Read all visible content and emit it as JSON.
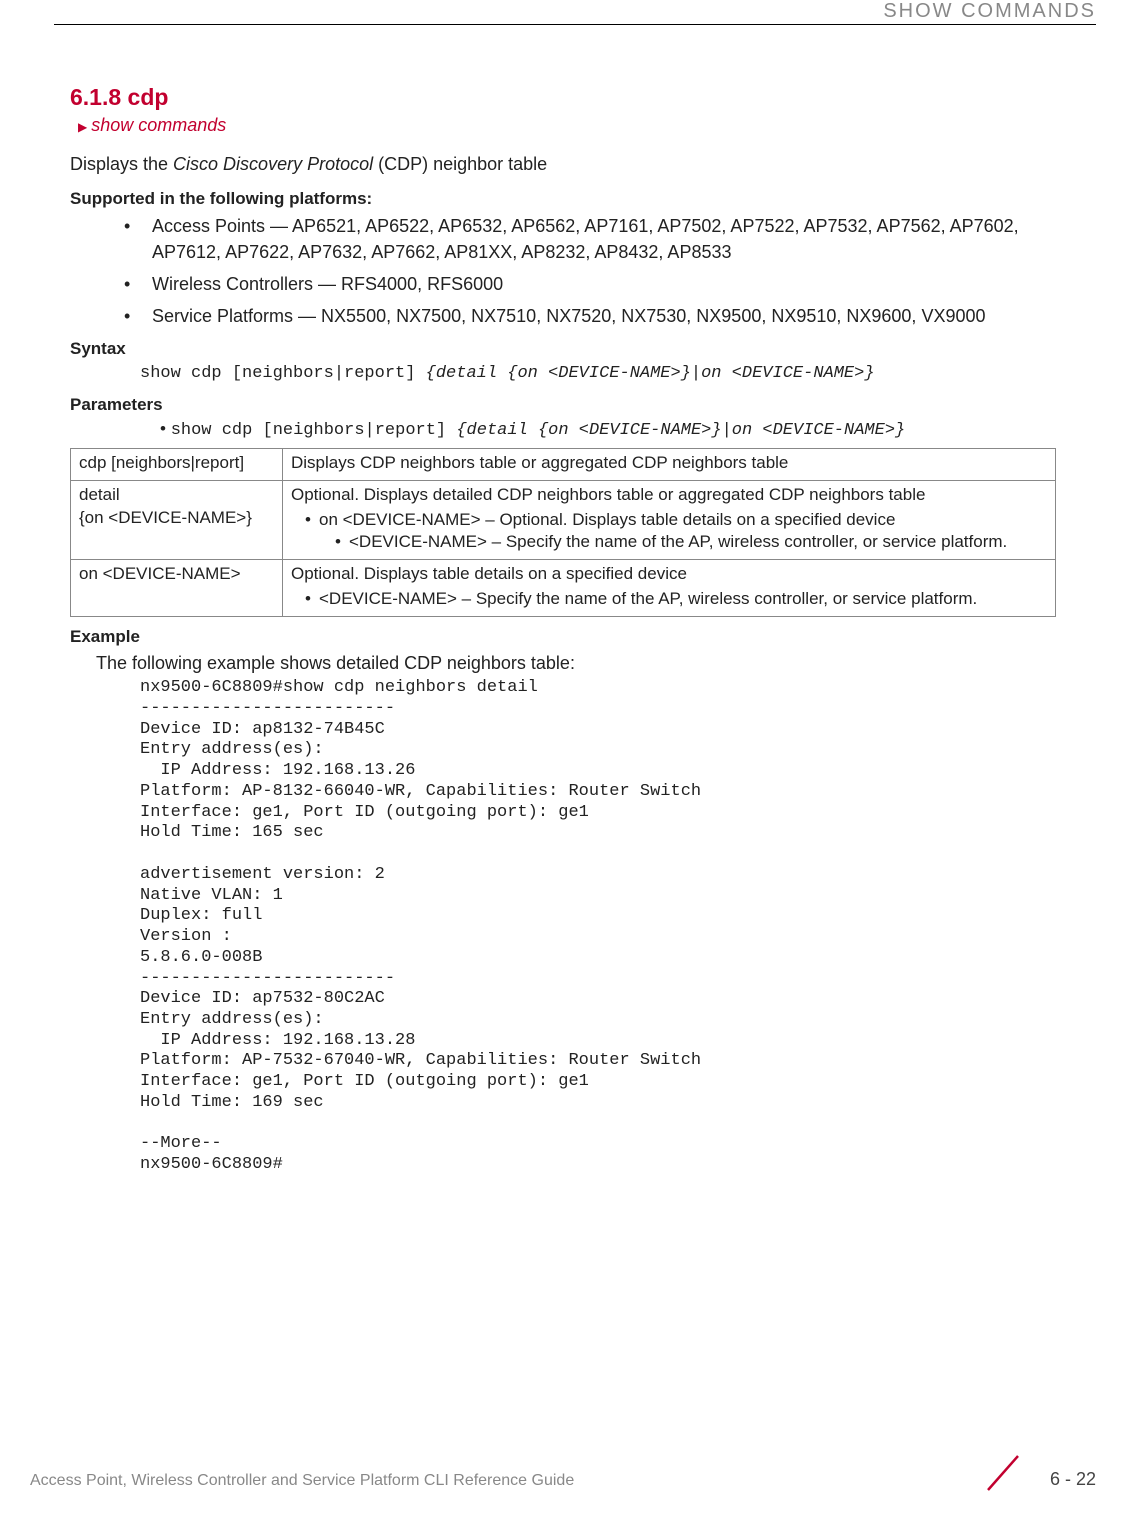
{
  "header": {
    "running_head": "SHOW COMMANDS"
  },
  "section": {
    "number_title": "6.1.8 cdp",
    "breadcrumb": "show commands",
    "lead_before_em": "Displays the ",
    "lead_em": "Cisco Discovery Protocol",
    "lead_after_em": " (CDP) neighbor table"
  },
  "platforms": {
    "heading": "Supported in the following platforms:",
    "items": [
      "Access Points — AP6521, AP6522, AP6532, AP6562, AP7161, AP7502, AP7522, AP7532, AP7562, AP7602, AP7612, AP7622, AP7632, AP7662, AP81XX, AP8232, AP8432, AP8533",
      "Wireless Controllers — RFS4000, RFS6000",
      "Service Platforms — NX5500, NX7500, NX7510, NX7520, NX7530, NX9500, NX9510, NX9600, VX9000"
    ]
  },
  "syntax": {
    "heading": "Syntax",
    "cmd_plain": "show cdp [neighbors|report] ",
    "cmd_ital": "{detail {on <DEVICE-NAME>}|on <DEVICE-NAME>}"
  },
  "parameters": {
    "heading": "Parameters",
    "line_plain": "show cdp [neighbors|report] ",
    "line_ital": "{detail {on <DEVICE-NAME>}|on <DEVICE-NAME>}",
    "rows": [
      {
        "k": "cdp [neighbors|report]",
        "desc": "Displays CDP neighbors table or aggregated CDP neighbors table"
      },
      {
        "k": "detail\n{on <DEVICE-NAME>}",
        "desc": "Optional. Displays detailed CDP neighbors table or aggregated CDP neighbors table",
        "sub1": "on <DEVICE-NAME> – Optional. Displays table details on a specified device",
        "sub2": "<DEVICE-NAME> – Specify the name of the AP, wireless controller, or service platform."
      },
      {
        "k": "on <DEVICE-NAME>",
        "desc": "Optional. Displays table details on a specified device",
        "sub1": "<DEVICE-NAME> – Specify the name of the AP, wireless controller, or service platform."
      }
    ]
  },
  "example": {
    "heading": "Example",
    "lead": "The following example shows detailed CDP neighbors table:",
    "output": "nx9500-6C8809#show cdp neighbors detail\n-------------------------\nDevice ID: ap8132-74B45C\nEntry address(es):\n  IP Address: 192.168.13.26\nPlatform: AP-8132-66040-WR, Capabilities: Router Switch\nInterface: ge1, Port ID (outgoing port): ge1\nHold Time: 165 sec\n\nadvertisement version: 2\nNative VLAN: 1\nDuplex: full\nVersion :\n5.8.6.0-008B\n-------------------------\nDevice ID: ap7532-80C2AC\nEntry address(es):\n  IP Address: 192.168.13.28\nPlatform: AP-7532-67040-WR, Capabilities: Router Switch\nInterface: ge1, Port ID (outgoing port): ge1\nHold Time: 169 sec\n\n--More--\nnx9500-6C8809#"
  },
  "footer": {
    "text": "Access Point, Wireless Controller and Service Platform CLI Reference Guide",
    "page": "6 - 22"
  }
}
